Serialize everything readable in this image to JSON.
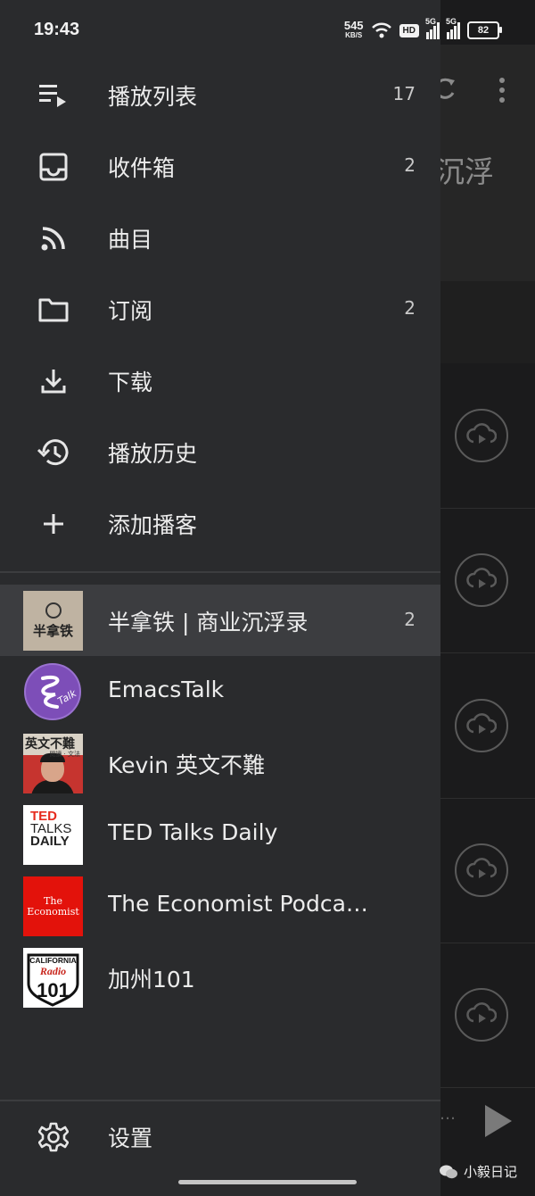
{
  "status_bar": {
    "time": "19:43",
    "net_speed": "545",
    "net_speed_unit": "KB/S",
    "hd_label": "HD",
    "sim1_label": "5G",
    "sim2_label": "5G",
    "battery": "82"
  },
  "background": {
    "title_fragment": "沉浮"
  },
  "drawer": {
    "nav_items": [
      {
        "label": "播放列表",
        "count": "17",
        "icon": "playlist-icon"
      },
      {
        "label": "收件箱",
        "count": "2",
        "icon": "inbox-icon"
      },
      {
        "label": "曲目",
        "count": "",
        "icon": "rss-feed-icon"
      },
      {
        "label": "订阅",
        "count": "2",
        "icon": "folder-icon"
      },
      {
        "label": "下载",
        "count": "",
        "icon": "download-icon"
      },
      {
        "label": "播放历史",
        "count": "",
        "icon": "history-icon"
      },
      {
        "label": "添加播客",
        "count": "",
        "icon": "plus-icon"
      }
    ],
    "subscriptions": [
      {
        "title": "半拿铁 | 商业沉浮录",
        "count": "2",
        "cover_text": "半拿铁"
      },
      {
        "title": "EmacsTalk",
        "count": "",
        "cover_text": "Talk"
      },
      {
        "title": "Kevin 英文不難",
        "count": "",
        "cover_text": "英文不難",
        "cover_sub": "閱讀 · 文法"
      },
      {
        "title": "TED Talks Daily",
        "count": "",
        "cover_lines": [
          "TED",
          "TALKS",
          "DAILY"
        ]
      },
      {
        "title": "The Economist Podcas…",
        "count": "",
        "cover_lines": [
          "The",
          "Economist"
        ]
      },
      {
        "title": "加州101",
        "count": "",
        "cover_lines": [
          "CALIFORNIA",
          "Radio",
          "101"
        ]
      }
    ],
    "settings_label": "设置"
  },
  "watermark": "小毅日记",
  "colors": {
    "drawer_bg": "#2a2b2d",
    "active_row": "#3c3d40",
    "text": "#ececec"
  }
}
